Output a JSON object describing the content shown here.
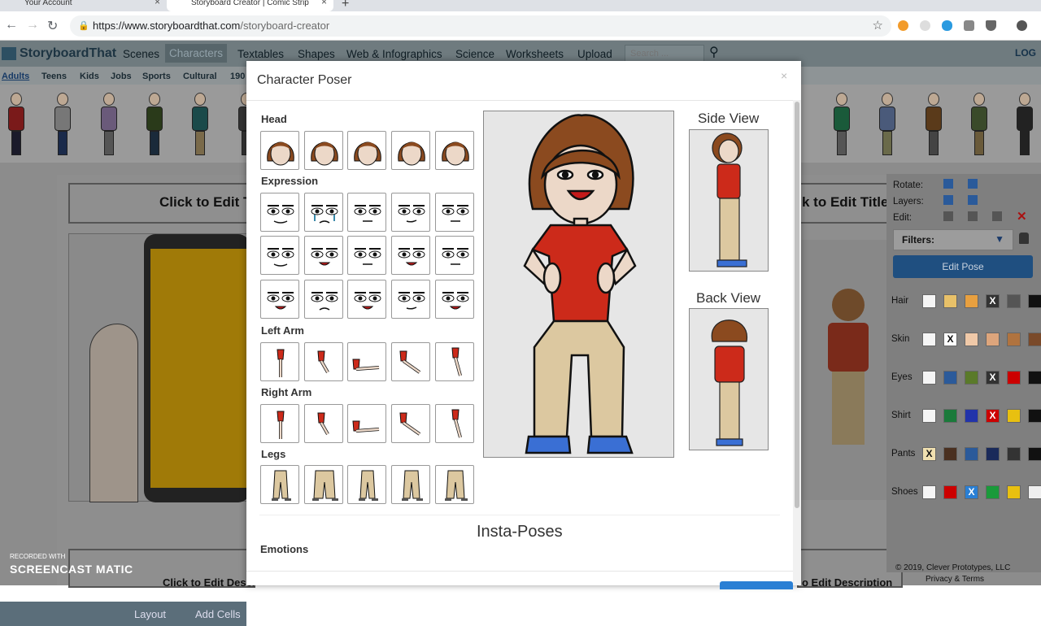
{
  "browser": {
    "tabs": [
      {
        "label": "Your Account"
      },
      {
        "label": "Storyboard Creator | Comic Strip"
      }
    ],
    "new_tab": "+",
    "url_host": "https://www.storyboardthat.com",
    "url_path": "/storyboard-creator"
  },
  "app": {
    "logo": "StoryboardThat",
    "nav": [
      "Scenes",
      "Characters",
      "Textables",
      "Shapes",
      "Web & Infographics",
      "Science",
      "Worksheets",
      "Upload"
    ],
    "search_placeholder": "Search ...",
    "login": "LOG",
    "char_categories": [
      "Adults",
      "Teens",
      "Kids",
      "Jobs",
      "Sports",
      "Cultural",
      "190"
    ],
    "title_left": "Click to Edit T",
    "title_right": "k to Edit Title",
    "desc_left": "Click to Edit Descr",
    "desc_right": "o Edit Description",
    "bottom_buttons": [
      "Layout",
      "Add Cells"
    ],
    "copyright": "© 2019, Clever Prototypes, LLC",
    "privacy": "Privacy & Terms",
    "accent": "#2a7fd4"
  },
  "right_panel": {
    "rotate": "Rotate:",
    "layers": "Layers:",
    "edit": "Edit:",
    "filters": "Filters:",
    "edit_pose": "Edit Pose",
    "rows": [
      {
        "label": "Hair",
        "colors": [
          "#f5f5f5",
          "#e8c169",
          "#e8a040",
          "#333333",
          "#555555",
          "#111111"
        ],
        "x_index": 3
      },
      {
        "label": "Skin",
        "colors": [
          "#f5f5f5",
          "#ffffff",
          "#f0c9a8",
          "#dda57c",
          "#b0733f",
          "#7a4a2a"
        ],
        "x_index": 1
      },
      {
        "label": "Eyes",
        "colors": [
          "#f5f5f5",
          "#2b5a9a",
          "#5a7a2a",
          "#333333",
          "#cc0000",
          "#111111"
        ],
        "x_index": 3
      },
      {
        "label": "Shirt",
        "colors": [
          "#f5f5f5",
          "#1a7a3a",
          "#2233aa",
          "#cc0000",
          "#e8c010",
          "#111111"
        ],
        "x_index": 3
      },
      {
        "label": "Pants",
        "colors": [
          "#f0e0b0",
          "#4a3020",
          "#2b5a9a",
          "#1a2a5a",
          "#333333",
          "#111111"
        ],
        "x_index": 0
      },
      {
        "label": "Shoes",
        "colors": [
          "#f5f5f5",
          "#cc0000",
          "#2a7fd4",
          "#1a9a3a",
          "#e8c010",
          "#eeeeee"
        ],
        "x_index": 2
      }
    ]
  },
  "modal": {
    "title": "Character Poser",
    "close": "×",
    "sections": {
      "head": "Head",
      "expression": "Expression",
      "left_arm": "Left Arm",
      "right_arm": "Right Arm",
      "legs": "Legs"
    },
    "side_view": "Side View",
    "back_view": "Back View",
    "insta_poses": "Insta-Poses",
    "emotions": "Emotions",
    "colors": {
      "hair": "#8b4a1f",
      "skin": "#ecd8c8",
      "shirt": "#cc2a1a",
      "pants": "#dcc8a0",
      "shoes": "#3a6fd4"
    }
  },
  "watermark": {
    "line1": "RECORDED WITH",
    "line2": "SCREENCAST",
    "line3": "MATIC"
  }
}
